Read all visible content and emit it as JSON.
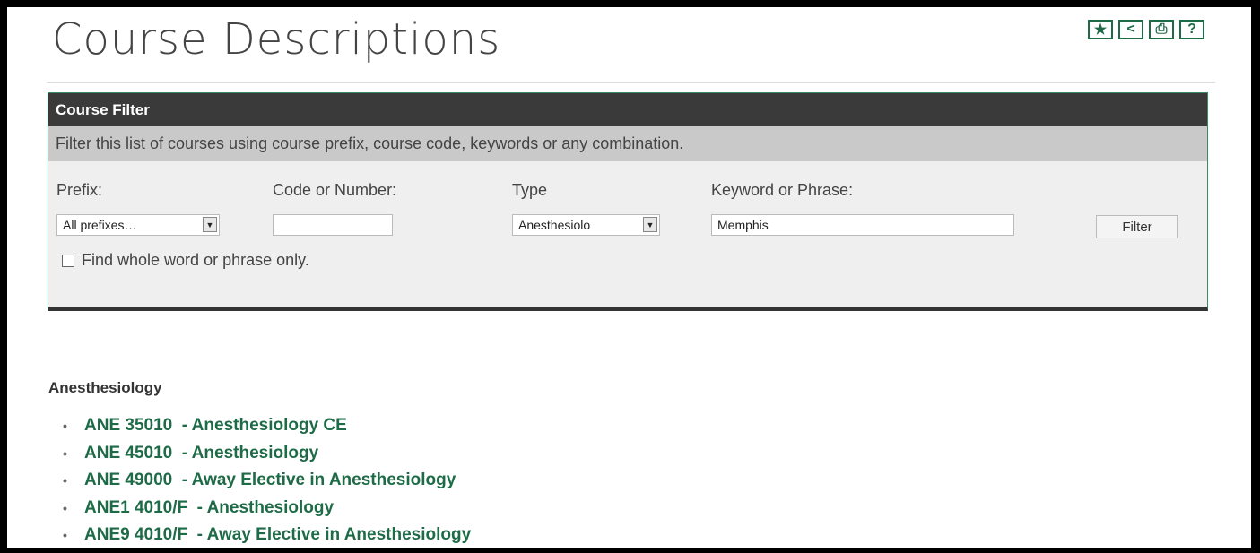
{
  "page": {
    "title": "Course Descriptions"
  },
  "toolbar": [
    {
      "icon": "star-icon",
      "glyph": "★"
    },
    {
      "icon": "share-icon",
      "glyph": "<"
    },
    {
      "icon": "print-icon",
      "glyph": "⎙"
    },
    {
      "icon": "help-icon",
      "glyph": "?"
    }
  ],
  "filter": {
    "header": "Course Filter",
    "description": "Filter this list of courses using course prefix, course code, keywords or any combination.",
    "prefix_label": "Prefix:",
    "prefix_value": "All prefixes…",
    "code_label": "Code or Number:",
    "code_value": "",
    "type_label": "Type",
    "type_value": "Anesthesiolo",
    "keyword_label": "Keyword or Phrase:",
    "keyword_value": "Memphis",
    "button_label": "Filter",
    "whole_word_label": "Find whole word or phrase only.",
    "whole_word_checked": false
  },
  "results": {
    "group": "Anesthesiology",
    "courses": [
      "ANE 35010  - Anesthesiology CE",
      "ANE 45010  - Anesthesiology",
      "ANE 49000  - Away Elective in Anesthesiology",
      "ANE1 4010/F  - Anesthesiology",
      "ANE9 4010/F  - Away Elective in Anesthesiology"
    ]
  },
  "colors": {
    "accent": "#1e6b47",
    "header_bg": "#3a3a3a",
    "desc_bg": "#c9c9c9"
  }
}
